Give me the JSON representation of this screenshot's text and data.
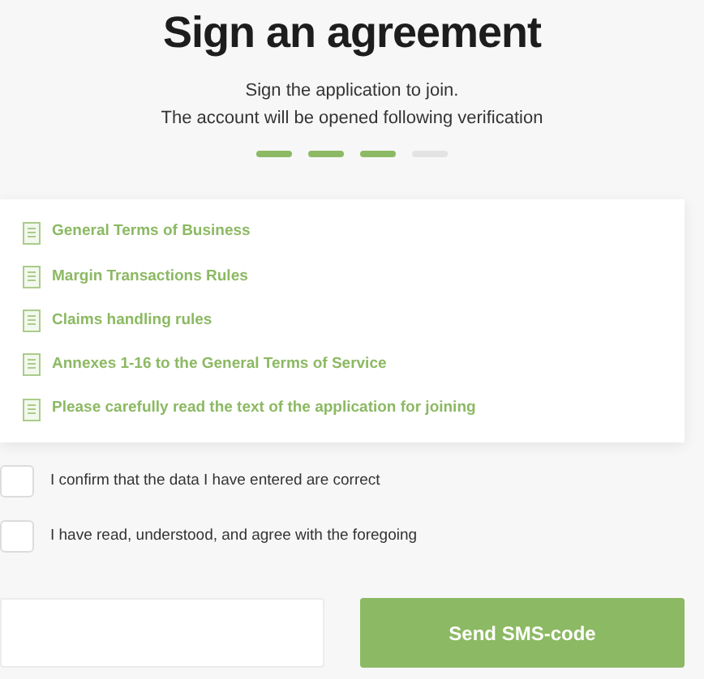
{
  "title": "Sign an agreement",
  "subtitle": [
    "Sign the application to join.",
    "The account will be opened following verification"
  ],
  "steps": [
    {
      "done": true
    },
    {
      "done": true
    },
    {
      "done": true
    },
    {
      "done": false
    }
  ],
  "documents": [
    {
      "label": "General Terms of Business"
    },
    {
      "label": "Margin Transactions Rules"
    },
    {
      "label": "Claims handling rules"
    },
    {
      "label": "Annexes 1-16 to the General Terms of Service"
    },
    {
      "label": "Please carefully read the text of the application for joining"
    }
  ],
  "confirmations": [
    {
      "label": "I confirm that the data I have entered are correct",
      "checked": false
    },
    {
      "label": "I have read, understood, and agree with the foregoing",
      "checked": false
    }
  ],
  "send_button": {
    "label": "Send SMS-code"
  }
}
